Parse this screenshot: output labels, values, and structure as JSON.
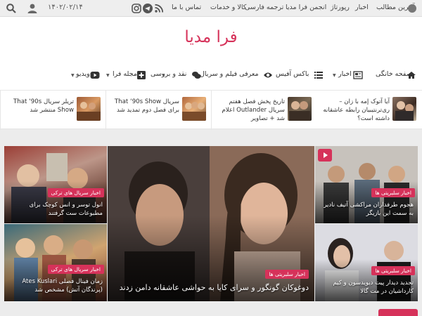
{
  "topbar": {
    "date": "۱۴۰۲/۰۲/۱۴",
    "links": [
      "آخرین مطالب",
      "اخبار",
      "رپورتاژ",
      "انجمن فرا مدیا",
      "ترجمه فارسی",
      "کالا و خدمات",
      "تماس با ما"
    ],
    "icons": [
      "search-icon",
      "user-icon",
      "instagram-icon",
      "telegram-icon",
      "rss-icon"
    ]
  },
  "header": {
    "logo": "فرا مدیا"
  },
  "nav": {
    "items": [
      {
        "label": "صفحه خانگی",
        "icon": "home-icon"
      },
      {
        "label": "اخبار",
        "icon": "newspaper-icon"
      },
      {
        "label": "باکس آفیس",
        "icon": "list-icon"
      },
      {
        "label": "معرفی فیلم و سریال",
        "icon": "eye-icon"
      },
      {
        "label": "نقد و بررسی",
        "icon": "chat-icon"
      },
      {
        "label": "مجله فرا",
        "icon": "plus-icon"
      },
      {
        "label": "ویدیو",
        "icon": "youtube-icon"
      }
    ]
  },
  "ticker": [
    {
      "title": "آیا آتوک إمه با زان‌ – ‌ری‌ترنتیبیان رابطه عاشقانه داشته است؟"
    },
    {
      "title": "تاریخ پخش فصل هفتم سریال Outlander اعلام شد + تصاویر"
    },
    {
      "title": "سریال That ‘90s Show برای فصل دوم تمدید شد"
    },
    {
      "title": "تریلر سریال That ‘90s Show منتشر شد"
    }
  ],
  "tiles": [
    {
      "badge": "اخبار سریال های ترکی",
      "caption": "انول توسر و انس کوچک برای مطبوعات ست گرفتند"
    },
    {
      "badge": "اخبار سریال های ترکی",
      "caption": "زمان فینال فصلی Ates Kuslari (پرندگان آتش) مشخص شد"
    },
    {
      "badge": "اخبار سلبریتی ها",
      "caption": "دوغوکان گونگور و سرای کایا به حواشی عاشقانه دامن زدند"
    },
    {
      "badge": "اخبار سلبریتی ها",
      "caption": "هجوم طرفداران مراکشی آتیف نادیر به سمت این بازیگر"
    },
    {
      "badge": "اخبار سلبریتی ها",
      "caption": "تجدید دیدار پیت دیویدسون و کیم کارداشیان در مت گالا"
    }
  ],
  "colors": {
    "accent": "#d6325a",
    "topbar": "#eeeeee"
  }
}
